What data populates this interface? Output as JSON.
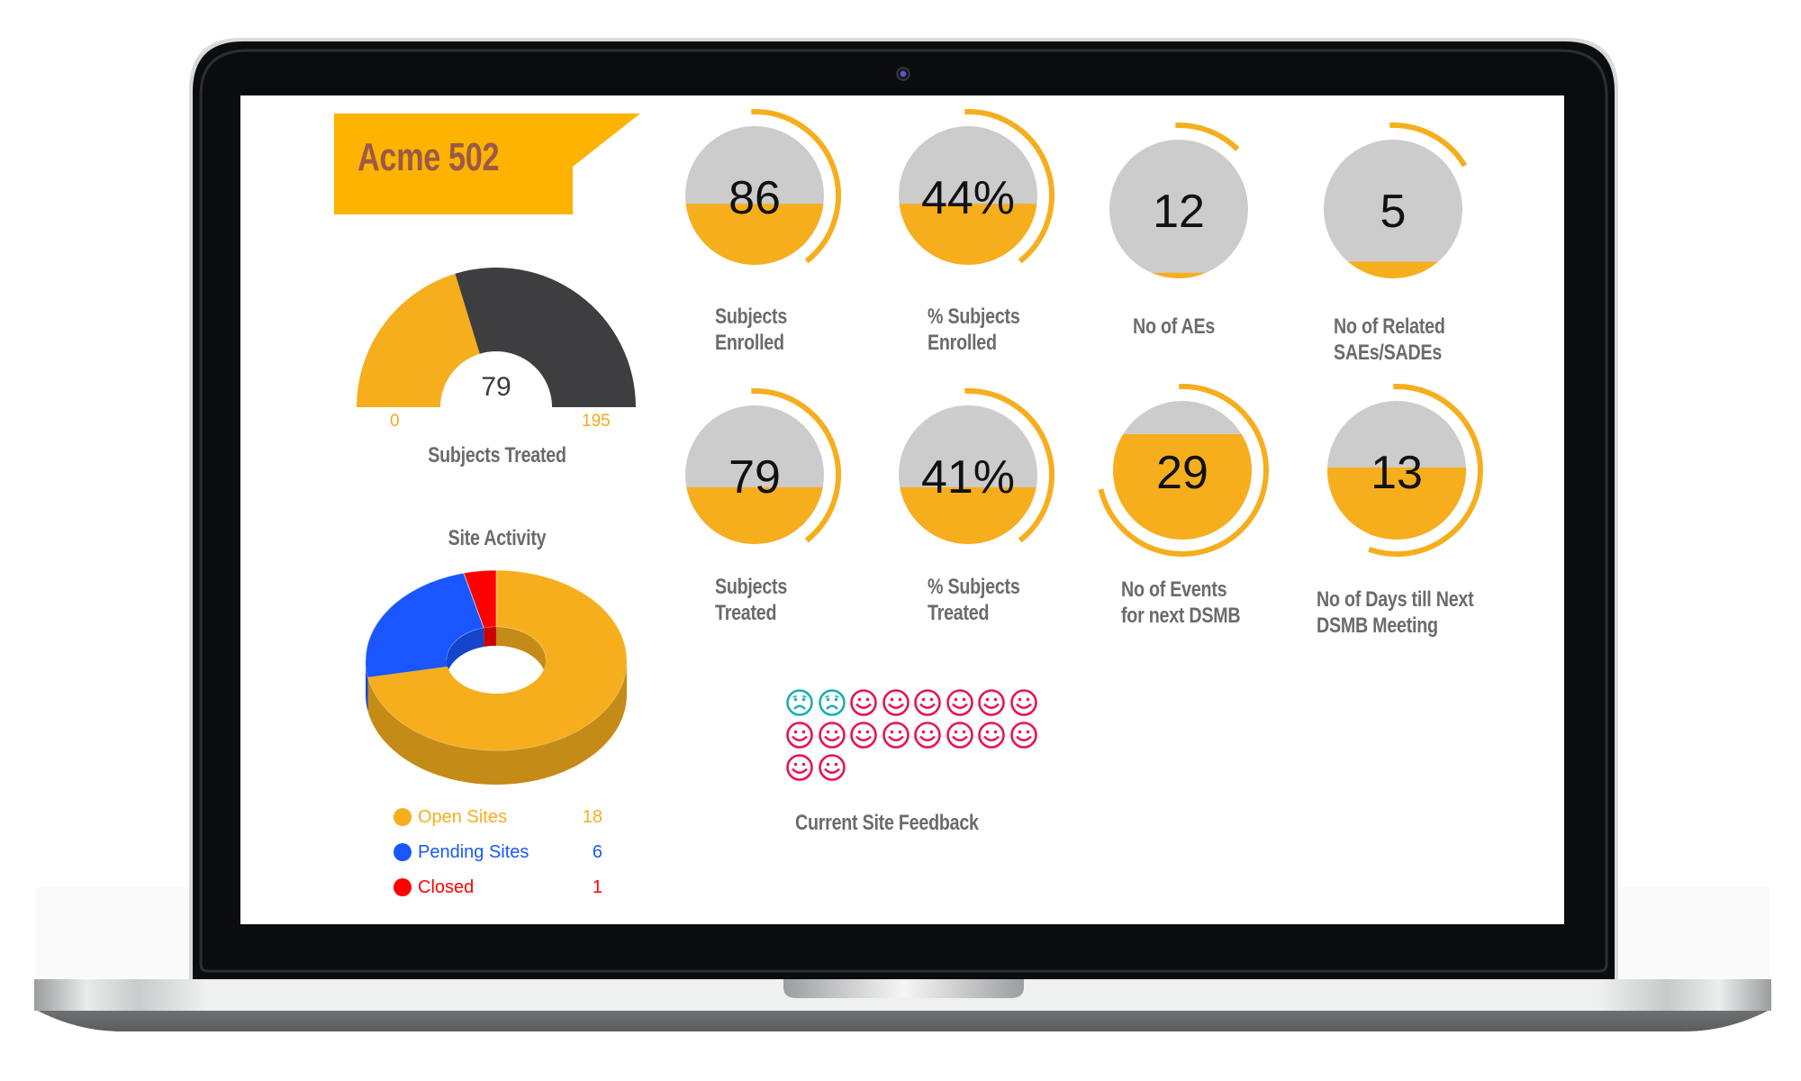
{
  "device": {
    "type": "laptop-mockup",
    "camera": "webcam-icon"
  },
  "colors": {
    "accent": "#F6AE1D",
    "banner": "#FDB300",
    "banner_text": "#9C5A46",
    "circle_bg": "#CCCCCC",
    "gauge_dark": "#3E3E40",
    "label_gray": "#6B6B6B",
    "open": "#F6AE1D",
    "pending": "#1A56FF",
    "closed": "#FF0000",
    "happy": "#E8144E",
    "sad": "#1BAEB8"
  },
  "header": {
    "title": "Acme 502"
  },
  "gauge": {
    "label": "Subjects Treated",
    "value": 79,
    "value_text": "79",
    "min": 0,
    "max": 195,
    "min_text": "0",
    "max_text": "195"
  },
  "site_activity": {
    "title": "Site Activity",
    "legend": [
      {
        "label": "Open Sites",
        "value": 18,
        "value_text": "18",
        "color": "#F6AE1D"
      },
      {
        "label": "Pending Sites",
        "value": 6,
        "value_text": "6",
        "color": "#1A56FF"
      },
      {
        "label": "Closed",
        "value": 1,
        "value_text": "1",
        "color": "#FF0000"
      }
    ]
  },
  "chart_data": [
    {
      "type": "gauge",
      "title": "Subjects Treated",
      "value": 79,
      "range": [
        0,
        195
      ],
      "tick_labels": [
        "0",
        "195"
      ]
    },
    {
      "type": "pie",
      "title": "Site Activity",
      "style": "3d-donut",
      "categories": [
        "Open Sites",
        "Pending Sites",
        "Closed"
      ],
      "values": [
        18,
        6,
        1
      ],
      "colors": [
        "#F6AE1D",
        "#1A56FF",
        "#FF0000"
      ],
      "legend": "bottom"
    }
  ],
  "kpis": [
    {
      "value_text": "86",
      "label_lines": [
        "Subjects",
        "Enrolled"
      ],
      "fill": 0.44,
      "arc": 0.4
    },
    {
      "value_text": "44%",
      "label_lines": [
        "% Subjects",
        "Enrolled"
      ],
      "fill": 0.44,
      "arc": 0.4
    },
    {
      "value_text": "12",
      "label_lines": [
        "No of AEs"
      ],
      "fill": 0.04,
      "arc": 0.13
    },
    {
      "value_text": "5",
      "label_lines": [
        "No of Related",
        "SAEs/SADEs"
      ],
      "fill": 0.12,
      "arc": 0.17
    },
    {
      "value_text": "79",
      "label_lines": [
        "Subjects",
        "Treated"
      ],
      "fill": 0.41,
      "arc": 0.4
    },
    {
      "value_text": "41%",
      "label_lines": [
        "% Subjects",
        "Treated"
      ],
      "fill": 0.41,
      "arc": 0.4
    },
    {
      "value_text": "29",
      "label_lines": [
        "No of Events",
        "for next DSMB"
      ],
      "fill": 0.76,
      "arc": 0.72
    },
    {
      "value_text": "13",
      "label_lines": [
        "No of Days till Next",
        "DSMB Meeting"
      ],
      "fill": 0.52,
      "arc": 0.56
    }
  ],
  "feedback": {
    "label": "Current Site Feedback",
    "sad_count": 2,
    "happy_count": 16
  }
}
